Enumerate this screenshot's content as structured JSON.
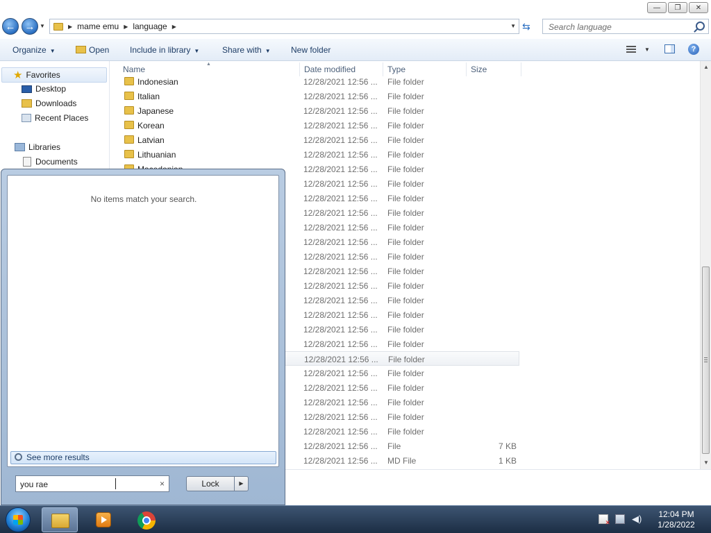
{
  "window": {
    "minimize": "—",
    "restore": "❐",
    "close": "✕"
  },
  "address": {
    "crumbs": [
      "mame emu",
      "language"
    ],
    "search_placeholder": "Search language"
  },
  "commandbar": {
    "organize": "Organize",
    "open": "Open",
    "include_in_library": "Include in library",
    "share_with": "Share with",
    "new_folder": "New folder",
    "help": "?"
  },
  "navpane": {
    "favorites": "Favorites",
    "desktop": "Desktop",
    "downloads": "Downloads",
    "recent_places": "Recent Places",
    "libraries": "Libraries",
    "documents": "Documents"
  },
  "columns": {
    "name": "Name",
    "date_modified": "Date modified",
    "type": "Type",
    "size": "Size"
  },
  "files": [
    {
      "name": "Indonesian",
      "date": "12/28/2021 12:56 ...",
      "type": "File folder",
      "size": ""
    },
    {
      "name": "Italian",
      "date": "12/28/2021 12:56 ...",
      "type": "File folder",
      "size": ""
    },
    {
      "name": "Japanese",
      "date": "12/28/2021 12:56 ...",
      "type": "File folder",
      "size": ""
    },
    {
      "name": "Korean",
      "date": "12/28/2021 12:56 ...",
      "type": "File folder",
      "size": ""
    },
    {
      "name": "Latvian",
      "date": "12/28/2021 12:56 ...",
      "type": "File folder",
      "size": ""
    },
    {
      "name": "Lithuanian",
      "date": "12/28/2021 12:56 ...",
      "type": "File folder",
      "size": ""
    },
    {
      "name": "Macedonian",
      "date": "12/28/2021 12:56 ...",
      "type": "File folder",
      "size": ""
    },
    {
      "name": "",
      "date": "12/28/2021 12:56 ...",
      "type": "File folder",
      "size": ""
    },
    {
      "name": "",
      "date": "12/28/2021 12:56 ...",
      "type": "File folder",
      "size": ""
    },
    {
      "name": "",
      "date": "12/28/2021 12:56 ...",
      "type": "File folder",
      "size": ""
    },
    {
      "name": "",
      "date": "12/28/2021 12:56 ...",
      "type": "File folder",
      "size": ""
    },
    {
      "name": "",
      "date": "12/28/2021 12:56 ...",
      "type": "File folder",
      "size": ""
    },
    {
      "name": "",
      "date": "12/28/2021 12:56 ...",
      "type": "File folder",
      "size": ""
    },
    {
      "name": "",
      "date": "12/28/2021 12:56 ...",
      "type": "File folder",
      "size": ""
    },
    {
      "name": "",
      "date": "12/28/2021 12:56 ...",
      "type": "File folder",
      "size": ""
    },
    {
      "name": "",
      "date": "12/28/2021 12:56 ...",
      "type": "File folder",
      "size": ""
    },
    {
      "name": "",
      "date": "12/28/2021 12:56 ...",
      "type": "File folder",
      "size": ""
    },
    {
      "name": "",
      "date": "12/28/2021 12:56 ...",
      "type": "File folder",
      "size": ""
    },
    {
      "name": "",
      "date": "12/28/2021 12:56 ...",
      "type": "File folder",
      "size": ""
    },
    {
      "name": "",
      "date": "12/28/2021 12:56 ...",
      "type": "File folder",
      "size": ""
    },
    {
      "name": "",
      "date": "12/28/2021 12:56 ...",
      "type": "File folder",
      "size": ""
    },
    {
      "name": "",
      "date": "12/28/2021 12:56 ...",
      "type": "File folder",
      "size": ""
    },
    {
      "name": "",
      "date": "12/28/2021 12:56 ...",
      "type": "File folder",
      "size": ""
    },
    {
      "name": "",
      "date": "12/28/2021 12:56 ...",
      "type": "File folder",
      "size": ""
    },
    {
      "name": "",
      "date": "12/28/2021 12:56 ...",
      "type": "File folder",
      "size": ""
    },
    {
      "name": "",
      "date": "12/28/2021 12:56 ...",
      "type": "File",
      "size": "7 KB"
    },
    {
      "name": "",
      "date": "12/28/2021 12:56 ...",
      "type": "MD File",
      "size": "1 KB"
    }
  ],
  "startmenu": {
    "no_items": "No items match your search.",
    "see_more": "See more results",
    "search_value": "you rae",
    "clear": "×",
    "lock": "Lock"
  },
  "taskbar": {
    "time": "12:04 PM",
    "date": "1/28/2022"
  }
}
